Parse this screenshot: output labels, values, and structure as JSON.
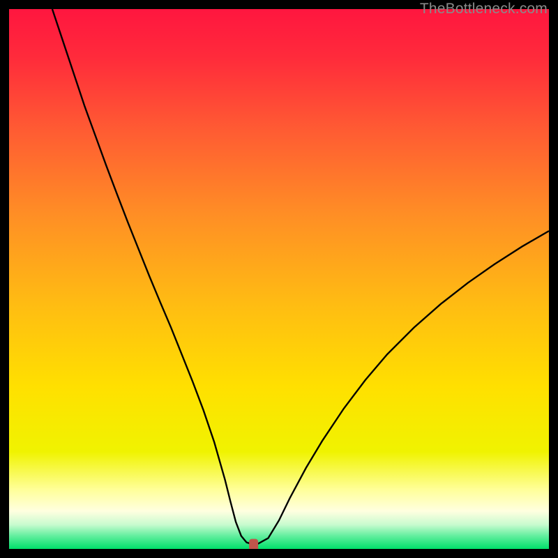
{
  "watermark": "TheBottleneck.com",
  "chart_data": {
    "type": "line",
    "title": "",
    "xlabel": "",
    "ylabel": "",
    "xlim": [
      0,
      100
    ],
    "ylim": [
      0,
      100
    ],
    "grid": false,
    "legend": false,
    "background_gradient": {
      "top_color": "#ff163f",
      "mid_color": "#ffd400",
      "bottom_color": "#00e46c"
    },
    "series": [
      {
        "name": "bottleneck-curve",
        "x": [
          8.0,
          10,
          12,
          14,
          16,
          18,
          20,
          22,
          24,
          26,
          28,
          30,
          32,
          34,
          36,
          38,
          40,
          41,
          42,
          43,
          44,
          45,
          46,
          48,
          50,
          52,
          55,
          58,
          62,
          66,
          70,
          75,
          80,
          85,
          90,
          95,
          100
        ],
        "y": [
          100,
          94,
          88,
          82,
          76.5,
          71,
          65.7,
          60.5,
          55.5,
          50.5,
          45.7,
          41,
          36,
          31,
          25.7,
          19.8,
          12.8,
          8.8,
          5.0,
          2.4,
          1.2,
          0.9,
          0.9,
          2.0,
          5.3,
          9.4,
          15.0,
          20.0,
          26.0,
          31.3,
          36.0,
          41.0,
          45.4,
          49.3,
          52.8,
          56.0,
          58.9
        ]
      }
    ],
    "marker": {
      "x": 45.3,
      "y": 0.7,
      "color": "#c1554b"
    }
  }
}
